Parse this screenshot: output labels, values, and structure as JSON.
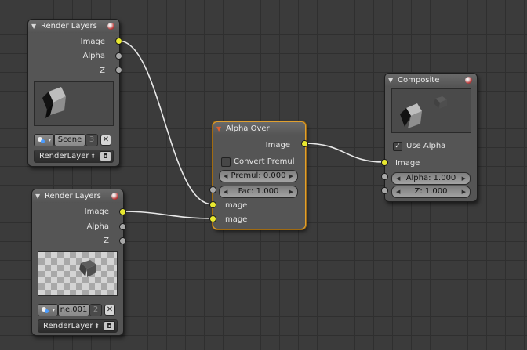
{
  "nodes": {
    "render_layers_1": {
      "title": "Render Layers",
      "outputs": [
        "Image",
        "Alpha",
        "Z"
      ],
      "scene": "Scene",
      "scene_users": "3",
      "layer": "RenderLayer"
    },
    "render_layers_2": {
      "title": "Render Layers",
      "outputs": [
        "Image",
        "Alpha",
        "Z"
      ],
      "scene": "ne.001",
      "scene_users": "2",
      "layer": "RenderLayer"
    },
    "alpha_over": {
      "title": "Alpha Over",
      "output": "Image",
      "convert_premul_label": "Convert Premul",
      "convert_premul_checked": false,
      "premul": "Premul: 0.000",
      "fac": "Fac: 1.000",
      "inputs": [
        "Image",
        "Image"
      ]
    },
    "composite": {
      "title": "Composite",
      "use_alpha_label": "Use Alpha",
      "use_alpha_checked": true,
      "input_image": "Image",
      "alpha": "Alpha: 1.000",
      "z": "Z: 1.000"
    }
  },
  "icons": {
    "collapse": "triangle-down-icon",
    "node_status": "red-sphere-icon",
    "scene_browse": "scene-browse-icon",
    "unlink": "x-icon",
    "layer_updown": "up-down-arrows-icon",
    "render_layer": "camera-icon",
    "checkbox": "checkmark-icon"
  },
  "colors": {
    "grid_background": "#3b3b3b",
    "node_body": "#555555",
    "active_node_outline": "#e0a030",
    "image_socket": "#e8e830",
    "value_socket": "#a8a8a8",
    "link": "#e8e8e8"
  }
}
